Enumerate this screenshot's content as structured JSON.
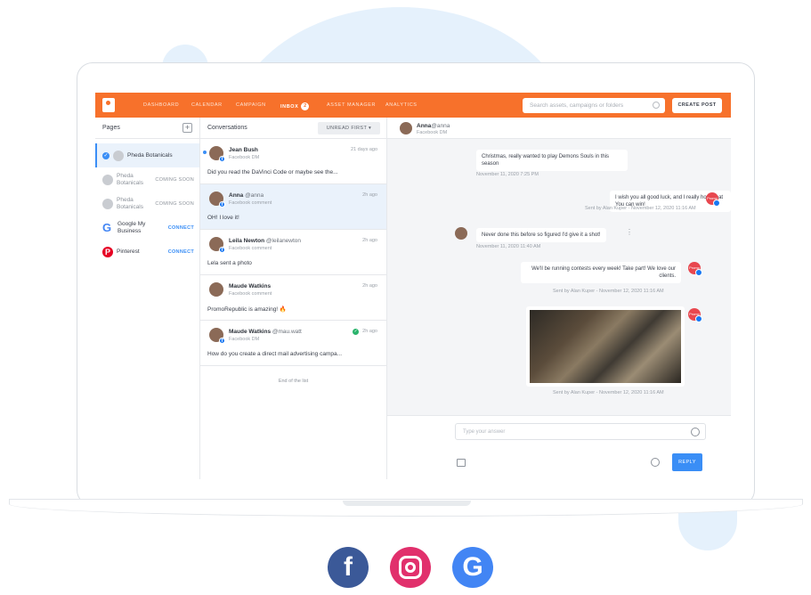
{
  "nav": {
    "items": [
      "DASHBOARD",
      "CALENDAR",
      "CAMPAIGN",
      "INBOX",
      "ASSET MANAGER",
      "ANALYTICS"
    ],
    "inbox_count": "2",
    "search_placeholder": "Search assets, campaigns or folders",
    "create_label": "CREATE POST",
    "brand_color": "#f7712b"
  },
  "pages": {
    "title": "Pages",
    "items": [
      {
        "label": "Pheda Botanicals",
        "status": ""
      },
      {
        "label": "Pheda Botanicals",
        "status": "COMING SOON"
      },
      {
        "label": "Pheda Botanicals",
        "status": "COMING SOON"
      },
      {
        "label": "Google My Business",
        "status": "CONNECT"
      },
      {
        "label": "Pinterest",
        "status": "CONNECT"
      }
    ]
  },
  "conversations": {
    "title": "Conversations",
    "filter_label": "UNREAD FIRST",
    "items": [
      {
        "name": "Jean Bush",
        "handle": "",
        "source": "Facebook DM",
        "time": "21 days ago",
        "message": "Did you read the DaVinci Code or maybe see the..."
      },
      {
        "name": "Anna",
        "handle": "@anna",
        "source": "Facebook comment",
        "time": "2h ago",
        "message": "OH! I love it!"
      },
      {
        "name": "Leila Newton",
        "handle": "@leilanewton",
        "source": "Facebook comment",
        "time": "2h ago",
        "message": "Lela sent a photo"
      },
      {
        "name": "Maude Watkins",
        "handle": "",
        "source": "Facebook comment",
        "time": "2h ago",
        "message": "PromoRepublic is amazing! 🔥"
      },
      {
        "name": "Maude Watkins",
        "handle": "@mau.watt",
        "source": "Facebook DM",
        "time": "2h ago",
        "message": "How do you create a direct mail advertising campa..."
      }
    ],
    "end_label": "End of the list"
  },
  "chat": {
    "header_name": "Anna",
    "header_handle": "@anna",
    "header_source": "Facebook DM",
    "messages": [
      {
        "text": "Christmas, really wanted to play Demons Souls in this season",
        "meta": "November 11, 2020 7:25 PM"
      },
      {
        "text": "I wish you all good luck, and I really hope that You can win!",
        "meta": "Sent by Alan Kuper - November 12, 2020 11:16 AM"
      },
      {
        "text": "Never done this before so figured I'd give it a shot!",
        "meta": "November 11, 2020 11:40 AM"
      },
      {
        "text": "We'll be running contests every week! Take part! We love our clients.",
        "meta": "Sent by Alan Kuper - November 12, 2020 11:16 AM"
      },
      {
        "text": "",
        "meta": "Sent by Alan Kuper - November 12, 2020 11:16 AM"
      }
    ],
    "answer_placeholder": "Type your answer",
    "reply_label": "REPLY"
  }
}
